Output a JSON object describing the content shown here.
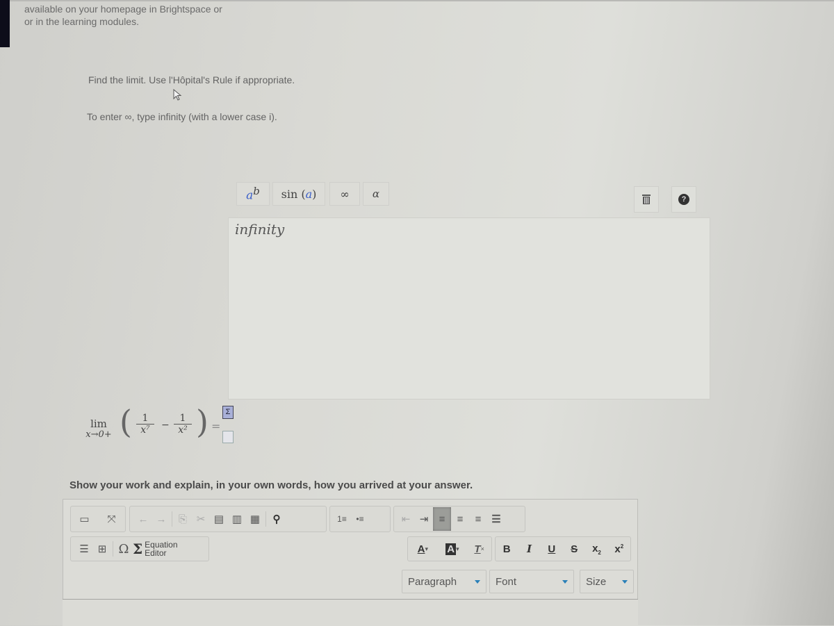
{
  "header": {
    "line1": "available on your homepage in Brightspace or",
    "line2": "or in the learning modules."
  },
  "question": {
    "instruction": "Find the limit. Use l'Hôpital's Rule if appropriate.",
    "hint": "To enter ∞, type infinity (with a lower case i)."
  },
  "math_editor": {
    "tools": [
      {
        "name": "power",
        "base": "a",
        "exp": "b"
      },
      {
        "name": "sin",
        "label": "sin",
        "arg": "a"
      },
      {
        "name": "infinity",
        "label": "∞"
      },
      {
        "name": "alpha",
        "label": "α"
      }
    ],
    "input_value": "infinity",
    "delete_icon": "trash-icon",
    "help_icon": "help-icon",
    "help_glyph": "?"
  },
  "problem": {
    "lim_label": "lim",
    "lim_sub": "x→0+",
    "lparen": "(",
    "rparen": ")",
    "num1": "1",
    "den1": "x⁷",
    "minus": "−",
    "num2": "1",
    "den2": "x²",
    "equals": "=",
    "sigma": "Σ"
  },
  "work": {
    "prompt": "Show your work and explain, in your own words, how you arrived at your answer.",
    "toolbar_row1": {
      "icons": [
        "source-icon",
        "fullscreen-icon",
        "undo-icon",
        "redo-icon",
        "copy-icon",
        "cut-icon",
        "paste-icon",
        "paste-text-icon",
        "paste-word-icon",
        "find-icon",
        "numbered-list-icon",
        "bullet-list-icon",
        "outdent-icon",
        "indent-icon",
        "align-left-icon",
        "align-center-icon",
        "align-right-icon",
        "justify-icon"
      ],
      "active_align": "left"
    },
    "toolbar_row2": {
      "insert_icons": [
        "horizontal-line-icon",
        "table-icon",
        "special-char-icon",
        "sigma-icon"
      ],
      "special_char": "Ω",
      "sigma": "Σ",
      "equation_editor_line1": "Equation",
      "equation_editor_line2": "Editor",
      "text_color": "A",
      "bg_color": "A",
      "clear_format": "T",
      "bold": "B",
      "italic": "I",
      "underline": "U",
      "strike": "S",
      "subscript": "x",
      "superscript": "x"
    },
    "paragraph_select": "Paragraph",
    "font_select": "Font",
    "size_select": "Size",
    "body_value": ""
  }
}
